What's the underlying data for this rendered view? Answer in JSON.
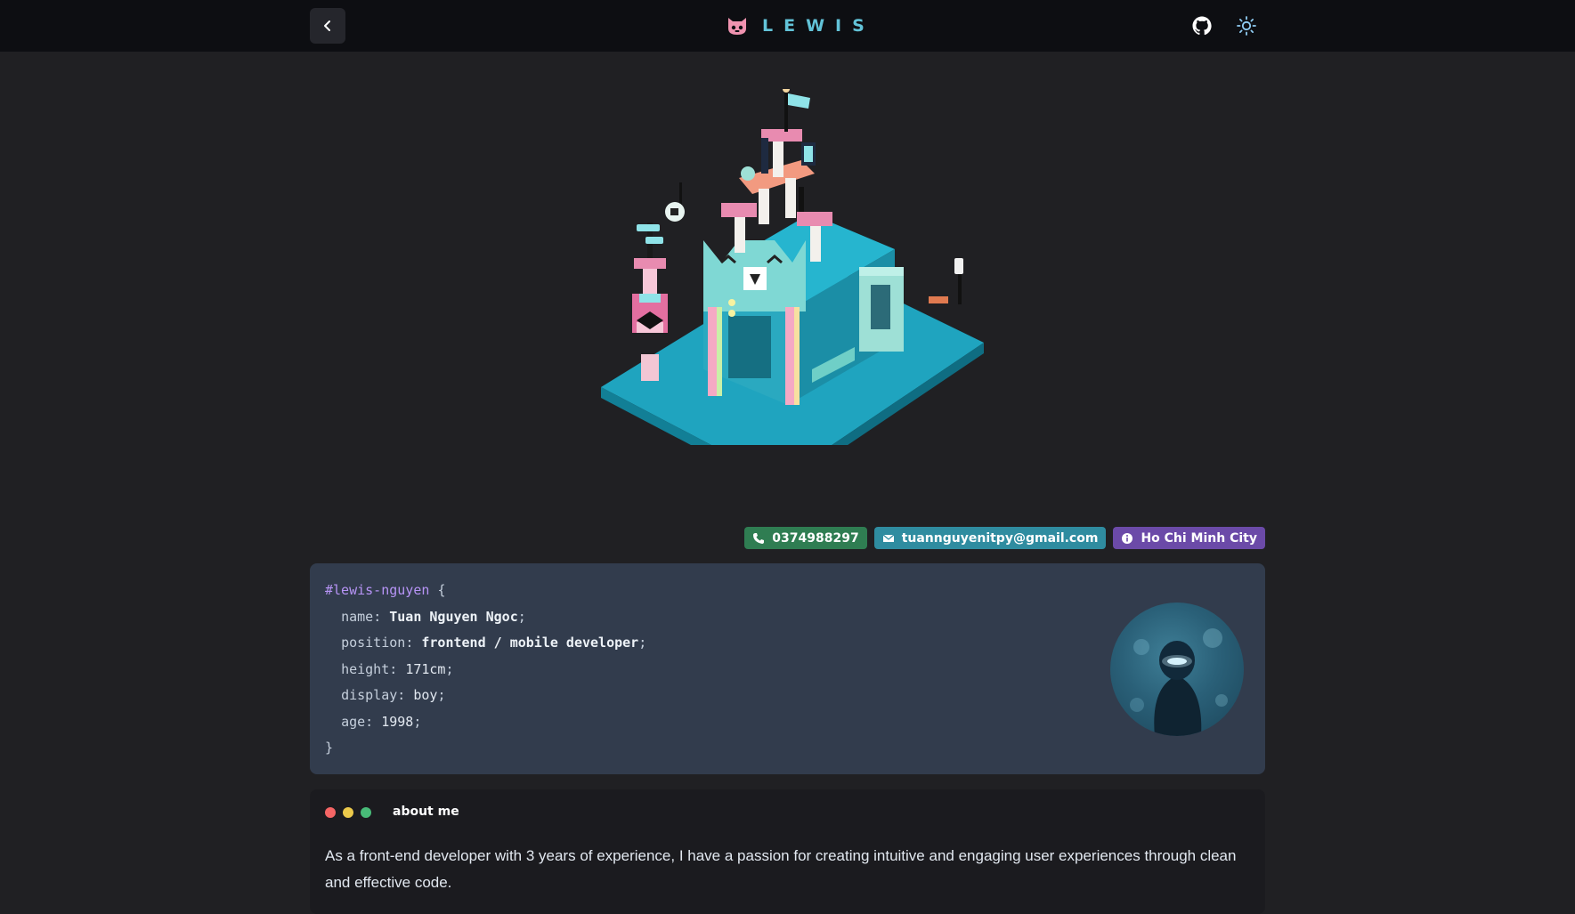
{
  "header": {
    "brand_name": "LEWIS",
    "back_icon": "chevron-left-icon",
    "logo_icon": "cat-face-icon",
    "github_icon": "github-icon",
    "theme_icon": "sun-icon"
  },
  "hero": {
    "scene": "isometric cat house voxel model"
  },
  "contacts": [
    {
      "icon": "phone-icon",
      "label": "0374988297",
      "color": "#2f7d52"
    },
    {
      "icon": "mail-icon",
      "label": "tuannguyenitpy@gmail.com",
      "color": "#2f8ca0"
    },
    {
      "icon": "info-icon",
      "label": "Ho Chi Minh City",
      "color": "#6b4aa8"
    }
  ],
  "profile_code": {
    "selector": "#lewis-nguyen",
    "open_brace": "{",
    "close_brace": "}",
    "props": [
      {
        "key": "name",
        "value": "Tuan Nguyen Ngoc"
      },
      {
        "key": "position",
        "value": "frontend / mobile developer"
      },
      {
        "key": "height",
        "value": "171cm"
      },
      {
        "key": "display",
        "value": "boy"
      },
      {
        "key": "age",
        "value": "1998"
      }
    ]
  },
  "about": {
    "title": "about me",
    "text": "As a front-end developer with 3 years of experience, I have a passion for creating intuitive and engaging user experiences through clean and effective code."
  },
  "colors": {
    "background": "#202023",
    "header": "#0d0e12",
    "card": "#323c4d",
    "accent_teal": "#62c3d8",
    "accent_pink": "#f093b0",
    "accent_purple": "#b794f6"
  }
}
